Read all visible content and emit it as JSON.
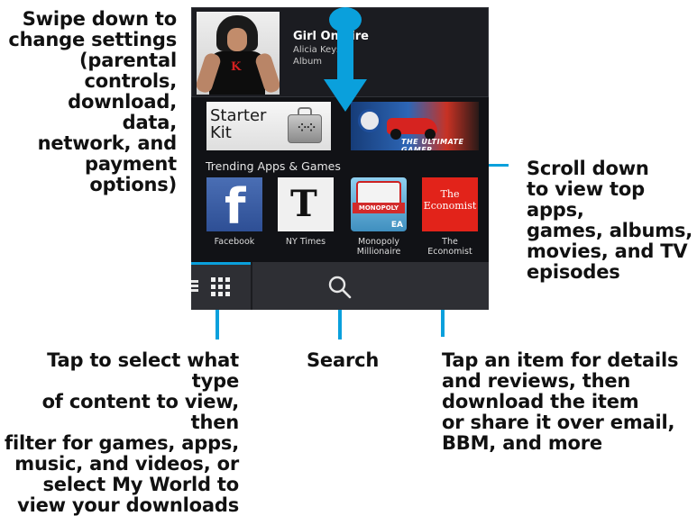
{
  "callouts": {
    "swipe": "Swipe down to\nchange settings\n(parental\ncontrols,\ndownload, data,\nnetwork, and\npayment\noptions)",
    "scroll": "Scroll down\nto view top apps,\ngames, albums,\nmovies, and TV\nepisodes",
    "tap_select": "Tap to select what type\nof content to view, then\nfilter for games, apps,\nmusic, and videos, or\nselect My World to\nview your downloads",
    "search": "Search",
    "tap_item": "Tap an item for details\nand reviews, then\ndownload the item\nor share it over email,\nBBM, and more"
  },
  "featured": {
    "title": "Girl On Fire",
    "artist": "Alicia Keys",
    "type": "Album",
    "album_logo": "K"
  },
  "banners": {
    "starter_kit": "Starter\nKit",
    "starter_kit_icon": "briefcase-icon",
    "game_banner_text": "THE ULTIMATE GAMER"
  },
  "section": {
    "title": "Trending Apps & Games"
  },
  "apps": [
    {
      "name": "Facebook",
      "glyph": "f"
    },
    {
      "name": "NY Times",
      "glyph": "T"
    },
    {
      "name": "Monopoly\nMillionaire",
      "glyph": "MONOPOLY",
      "brand": "EA"
    },
    {
      "name": "The\nEconomist",
      "glyph": "The\nEconomist"
    }
  ],
  "bottom_bar": {
    "left_icons": [
      "menu-lines-icon",
      "grid-icon"
    ],
    "center_icon": "search-icon"
  },
  "colors": {
    "accent": "#0aa0dc",
    "screen_bg": "#111216",
    "bar_bg": "#2e2f34",
    "facebook": "#3b5998",
    "economist": "#e2231a"
  }
}
